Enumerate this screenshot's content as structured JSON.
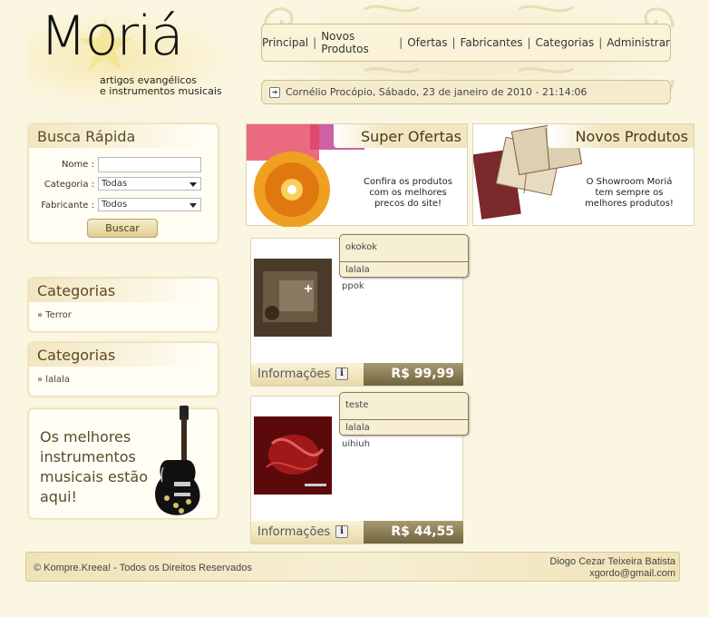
{
  "header": {
    "logo_text": "Moriá",
    "logo_sub_line1": "artigos evangélicos",
    "logo_sub_line2": "e instrumentos musicais",
    "menu": [
      "Principal",
      "Novos Produtos",
      "Ofertas",
      "Fabricantes",
      "Categorias",
      "Administrar"
    ],
    "menu_separator": "|",
    "datetime": "Cornélio Procópio, Sábado, 23 de janeiro de 2010 - 21:14:06"
  },
  "search": {
    "title": "Busca Rápida",
    "name_label": "Nome :",
    "category_label": "Categoria :",
    "category_value": "Todas",
    "manufacturer_label": "Fabricante :",
    "manufacturer_value": "Todos",
    "button": "Buscar"
  },
  "categories_boxes": [
    {
      "title": "Categorias",
      "item": "» Terror"
    },
    {
      "title": "Categorias",
      "item": "» lalala"
    }
  ],
  "promo": {
    "line1": "Os melhores",
    "line2": "instrumentos",
    "line3": "musicais estão",
    "line4": "aqui!"
  },
  "banners": [
    {
      "title": "Super Ofertas",
      "desc1": "Confira os produtos",
      "desc2": "com os melhores",
      "desc3": "precos do site!"
    },
    {
      "title": "Novos Produtos",
      "desc1": "O Showroom Moriá",
      "desc2": "tem sempre os",
      "desc3": "melhores produtos!"
    }
  ],
  "products": [
    {
      "tip_name": "okokok",
      "tip_sub": "lalala",
      "desc": "ppok",
      "info_label": "Informações",
      "info_icon": "i",
      "price": "R$ 99,99"
    },
    {
      "tip_name": "teste",
      "tip_sub": "lalala",
      "desc": "uihiuh",
      "info_label": "Informações",
      "info_icon": "i",
      "price": "R$ 44,55"
    }
  ],
  "footer": {
    "left": "© Kompre.Kreea! - Todos os Direitos Reservados",
    "right_line1": "Diogo Cezar Teixeira Batista",
    "right_line2": "xgordo@gmail.com"
  },
  "icons": {
    "arrow": "arrow-right-icon",
    "dropdown": "chevron-down-icon",
    "info": "info-icon"
  },
  "colors": {
    "background": "#fbf6e1",
    "accent": "#cdbf8f",
    "price_bg": "#8a7c56"
  }
}
